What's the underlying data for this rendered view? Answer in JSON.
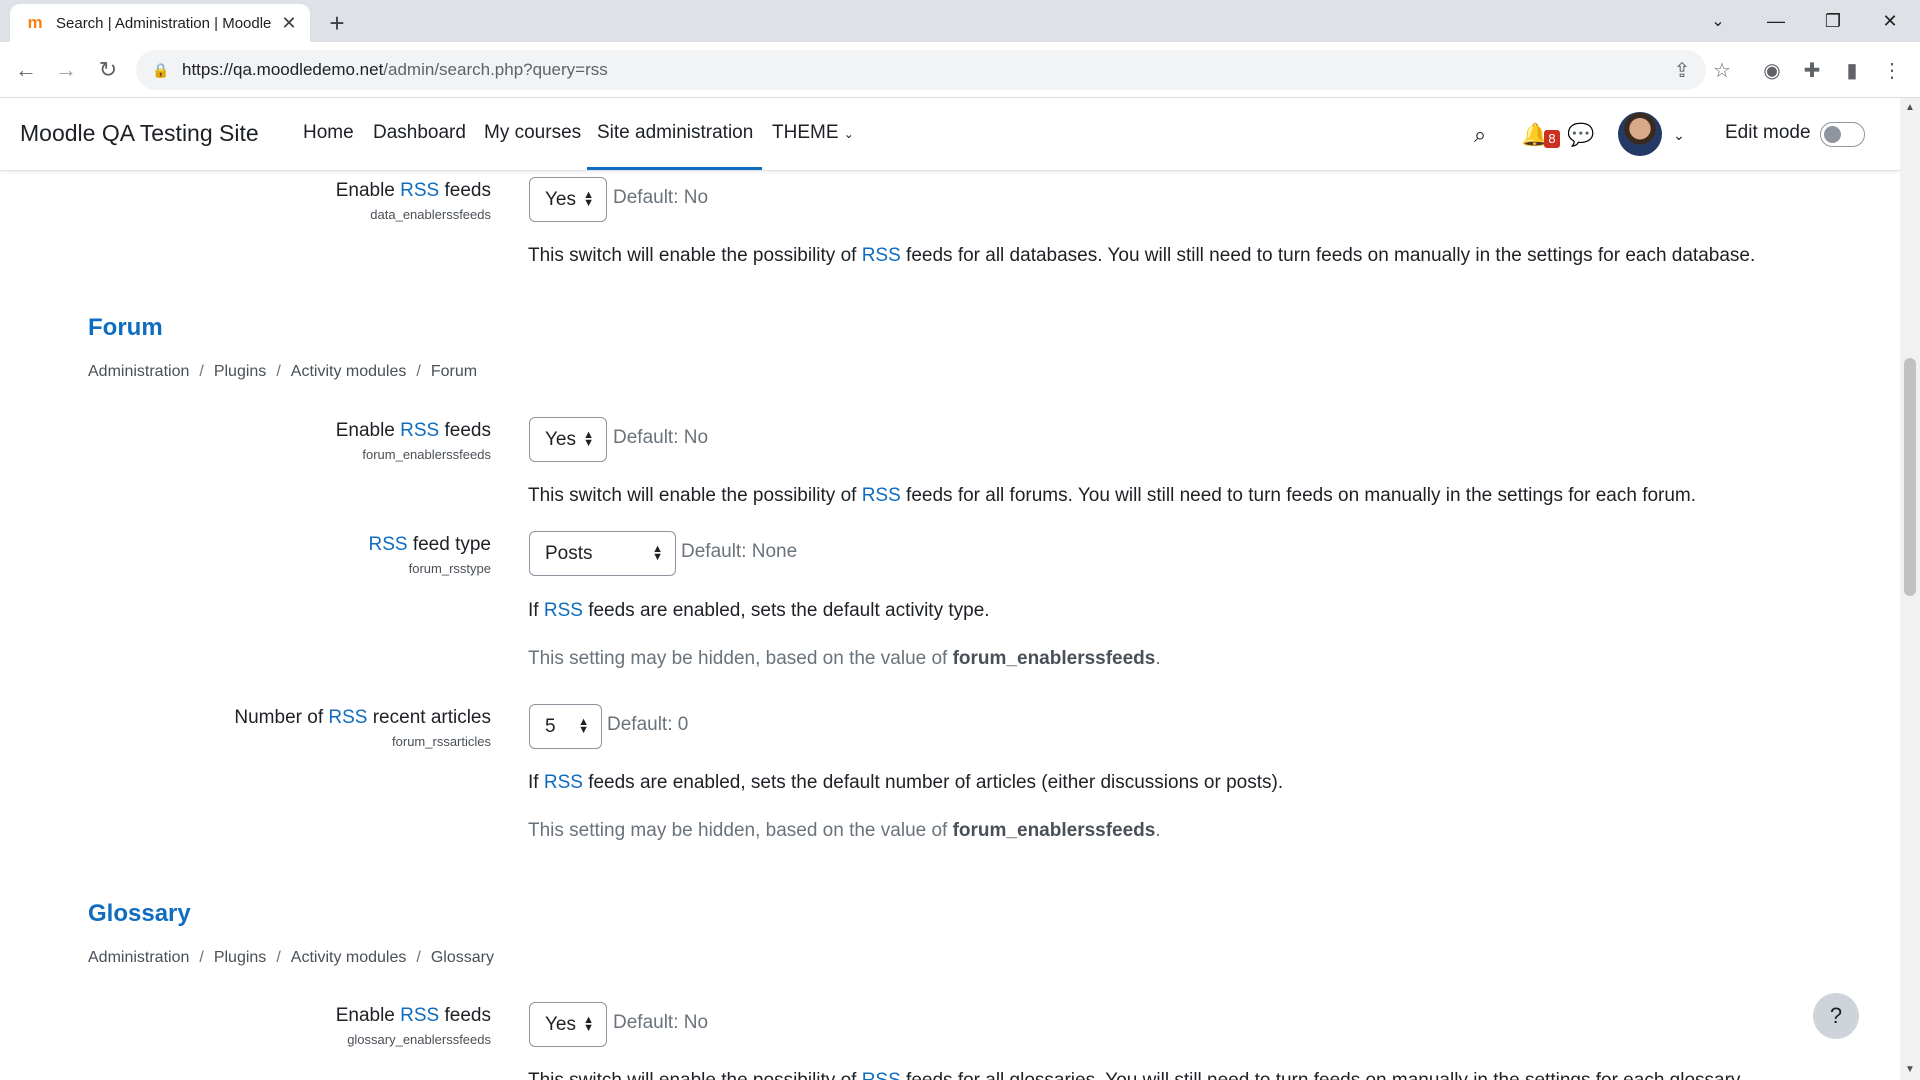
{
  "browser": {
    "tab_title": "Search | Administration | Moodle",
    "tab_favicon": "m",
    "url_host": "https://qa.moodledemo.net",
    "url_path": "/admin/search.php?query=rss"
  },
  "navbar": {
    "brand": "Moodle QA Testing Site",
    "items": [
      "Home",
      "Dashboard",
      "My courses",
      "Site administration",
      "THEME"
    ],
    "notification_count": "8",
    "edit_mode_label": "Edit mode"
  },
  "rss_word": "RSS",
  "data_section": {
    "enable": {
      "label_pre": "Enable ",
      "label_post": " feeds",
      "key": "data_enablerssfeeds",
      "value": "Yes",
      "default": "Default: No",
      "desc_pre": "This switch will enable the possibility of ",
      "desc_post": " feeds for all databases. You will still need to turn feeds on manually in the settings for each database."
    }
  },
  "forum_section": {
    "heading": "Forum",
    "breadcrumb": [
      "Administration",
      "Plugins",
      "Activity modules",
      "Forum"
    ],
    "enable": {
      "label_pre": "Enable ",
      "label_post": " feeds",
      "key": "forum_enablerssfeeds",
      "value": "Yes",
      "default": "Default: No",
      "desc_pre": "This switch will enable the possibility of ",
      "desc_post": " feeds for all forums. You will still need to turn feeds on manually in the settings for each forum."
    },
    "feed_type": {
      "label_post": " feed type",
      "key": "forum_rsstype",
      "value": "Posts",
      "default": "Default: None",
      "desc_pre": "If ",
      "desc_post": " feeds are enabled, sets the default activity type.",
      "note_pre": "This setting may be hidden, based on the value of ",
      "note_bold": "forum_enablerssfeeds",
      "note_post": "."
    },
    "articles": {
      "label_pre": "Number of ",
      "label_post": " recent articles",
      "key": "forum_rssarticles",
      "value": "5",
      "default": "Default: 0",
      "desc_pre": "If ",
      "desc_post": " feeds are enabled, sets the default number of articles (either discussions or posts).",
      "note_pre": "This setting may be hidden, based on the value of ",
      "note_bold": "forum_enablerssfeeds",
      "note_post": "."
    }
  },
  "glossary_section": {
    "heading": "Glossary",
    "breadcrumb": [
      "Administration",
      "Plugins",
      "Activity modules",
      "Glossary"
    ],
    "enable": {
      "label_pre": "Enable ",
      "label_post": " feeds",
      "key": "glossary_enablerssfeeds",
      "value": "Yes",
      "default": "Default: No",
      "desc_pre": "This switch will enable the possibility of ",
      "desc_post": " feeds for all glossaries. You will still need to turn feeds on manually in the settings for each glossary."
    }
  },
  "help_label": "?"
}
